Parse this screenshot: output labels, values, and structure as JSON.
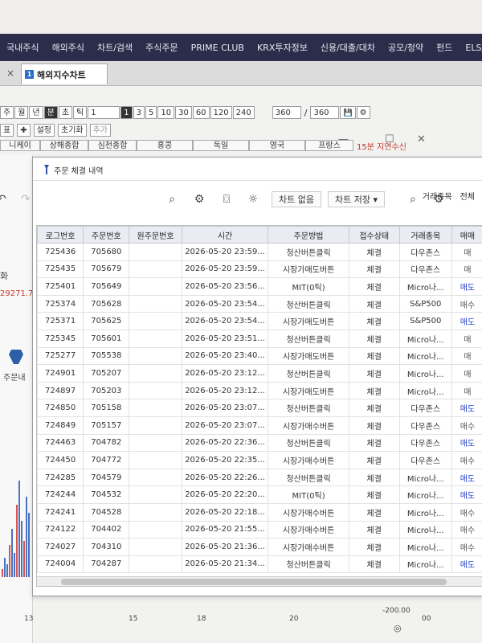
{
  "menu": [
    "국내주식",
    "해외주식",
    "차트/검색",
    "주식주문",
    "PRIME CLUB",
    "KRX투자정보",
    "신용/대출/대차",
    "공모/청약",
    "펀드",
    "ELS/"
  ],
  "tab": {
    "close": "×",
    "badge": "1",
    "label": "해외지수차트"
  },
  "toolbar1": {
    "period_buttons": [
      "주",
      "월",
      "년",
      "분",
      "초",
      "틱"
    ],
    "period_value": "1",
    "interval_active": "1",
    "intervals": [
      "3",
      "5",
      "10",
      "30",
      "60",
      "120",
      "240"
    ],
    "count_value": "360",
    "separator": "/",
    "count_total": "360"
  },
  "toolbar2": {
    "small": "표",
    "setting": "설정",
    "reset": "초기화",
    "add": "추가"
  },
  "index_tabs": [
    "니케이",
    "상해종합",
    "심천종합",
    "홍콩",
    "독일",
    "영국",
    "프랑스"
  ],
  "index_note": "15분 지연수신",
  "behind": {
    "price_text": "29271.7",
    "side_label": "주문내",
    "left_label": "화"
  },
  "window": {
    "min": "—",
    "max": "☐",
    "close": "✕"
  },
  "chart_toolbar": {
    "no_chart": "차트 없음",
    "save_chart": "차트 저장 ▾"
  },
  "panel": {
    "title": "주문 체결 내역",
    "filter_label": "거래종목",
    "filter_value": "전체"
  },
  "grid": {
    "headers": [
      "로그번호",
      "주문번호",
      "원주문번호",
      "시간",
      "주문방법",
      "접수상태",
      "거래종목",
      "매매"
    ],
    "rows": [
      [
        "725436",
        "705680",
        "",
        "2026-05-20 23:59...",
        "청산버튼클릭",
        "체결",
        "다우존스",
        "매"
      ],
      [
        "725435",
        "705679",
        "",
        "2026-05-20 23:59...",
        "시장가매도버튼",
        "체결",
        "다우존스",
        "매"
      ],
      [
        "725401",
        "705649",
        "",
        "2026-05-20 23:56...",
        "MIT(0틱)",
        "체결",
        "Micro나...",
        "매도"
      ],
      [
        "725374",
        "705628",
        "",
        "2026-05-20 23:54...",
        "청산버튼클릭",
        "체결",
        "S&P500",
        "매수"
      ],
      [
        "725371",
        "705625",
        "",
        "2026-05-20 23:54...",
        "시장가매도버튼",
        "체결",
        "S&P500",
        "매도"
      ],
      [
        "725345",
        "705601",
        "",
        "2026-05-20 23:51...",
        "청산버튼클릭",
        "체결",
        "Micro나...",
        "매"
      ],
      [
        "725277",
        "705538",
        "",
        "2026-05-20 23:40...",
        "시장가매도버튼",
        "체결",
        "Micro나...",
        "매"
      ],
      [
        "724901",
        "705207",
        "",
        "2026-05-20 23:12...",
        "청산버튼클릭",
        "체결",
        "Micro나...",
        "매"
      ],
      [
        "724897",
        "705203",
        "",
        "2026-05-20 23:12...",
        "시장가매도버튼",
        "체결",
        "Micro나...",
        "매"
      ],
      [
        "724850",
        "705158",
        "",
        "2026-05-20 23:07...",
        "청산버튼클릭",
        "체결",
        "다우존스",
        "매도"
      ],
      [
        "724849",
        "705157",
        "",
        "2026-05-20 23:07...",
        "시장가매수버튼",
        "체결",
        "다우존스",
        "매수"
      ],
      [
        "724463",
        "704782",
        "",
        "2026-05-20 22:36...",
        "청산버튼클릭",
        "체결",
        "다우존스",
        "매도"
      ],
      [
        "724450",
        "704772",
        "",
        "2026-05-20 22:35...",
        "시장가매수버튼",
        "체결",
        "다우존스",
        "매수"
      ],
      [
        "724285",
        "704579",
        "",
        "2026-05-20 22:26...",
        "청산버튼클릭",
        "체결",
        "Micro나...",
        "매도"
      ],
      [
        "724244",
        "704532",
        "",
        "2026-05-20 22:20...",
        "MIT(0틱)",
        "체결",
        "Micro나...",
        "매도"
      ],
      [
        "724241",
        "704528",
        "",
        "2026-05-20 22:18...",
        "시장가매수버튼",
        "체결",
        "Micro나...",
        "매수"
      ],
      [
        "724122",
        "704402",
        "",
        "2026-05-20 21:55...",
        "시장가매수버튼",
        "체결",
        "Micro나...",
        "매수"
      ],
      [
        "724027",
        "704310",
        "",
        "2026-05-20 21:36...",
        "시장가매수버튼",
        "체결",
        "Micro나...",
        "매수"
      ],
      [
        "724004",
        "704287",
        "",
        "2026-05-20 21:34...",
        "청산버튼클릭",
        "체결",
        "Micro나...",
        "매도"
      ]
    ]
  },
  "bottom_axis": {
    "ticks": [
      "13",
      "15",
      "18",
      "20",
      "00"
    ],
    "value": "-200.00"
  }
}
